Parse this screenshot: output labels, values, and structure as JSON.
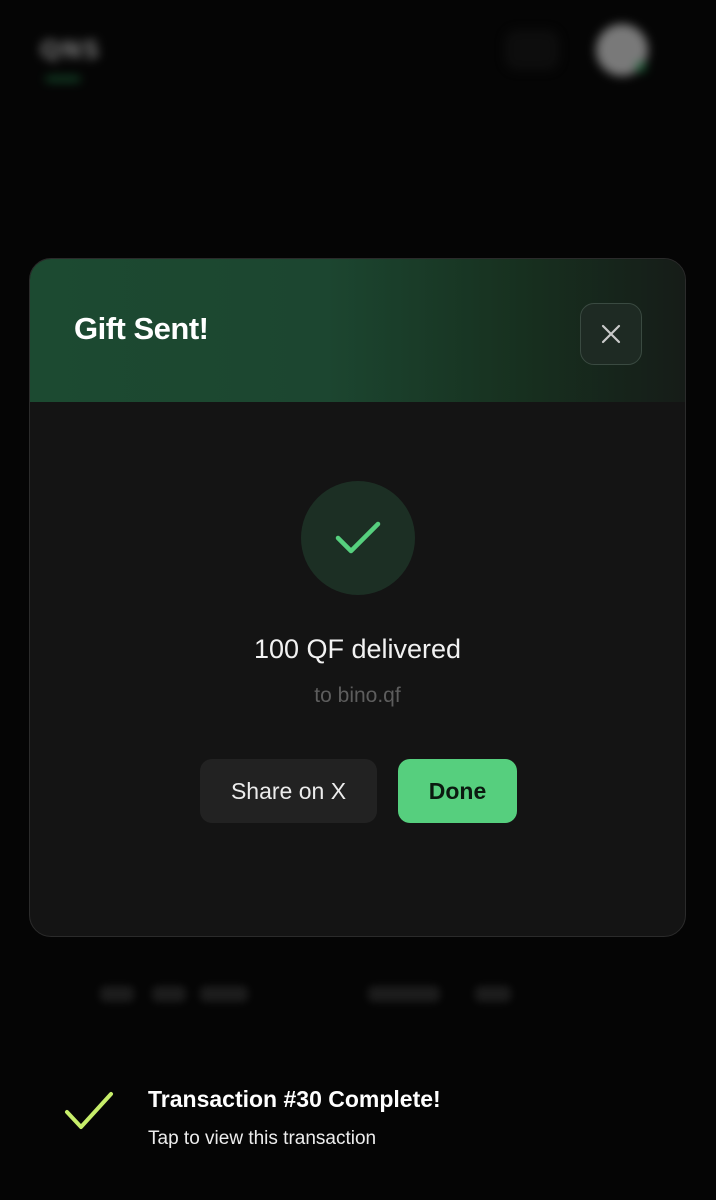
{
  "background": {
    "app_logo_text": "QNS"
  },
  "modal": {
    "title": "Gift Sent!",
    "close_icon": "close-icon",
    "success_icon": "check-icon",
    "amount_text": "100 QF delivered",
    "recipient_text": "to bino.qf",
    "share_label": "Share on X",
    "done_label": "Done",
    "colors": {
      "accent": "#56cf7e",
      "header": "#1c4a31",
      "surface": "#141414"
    }
  },
  "toast": {
    "icon": "check-icon",
    "title": "Transaction #30 Complete!",
    "subtitle": "Tap to view this transaction",
    "icon_color": "#c7ee6a"
  }
}
